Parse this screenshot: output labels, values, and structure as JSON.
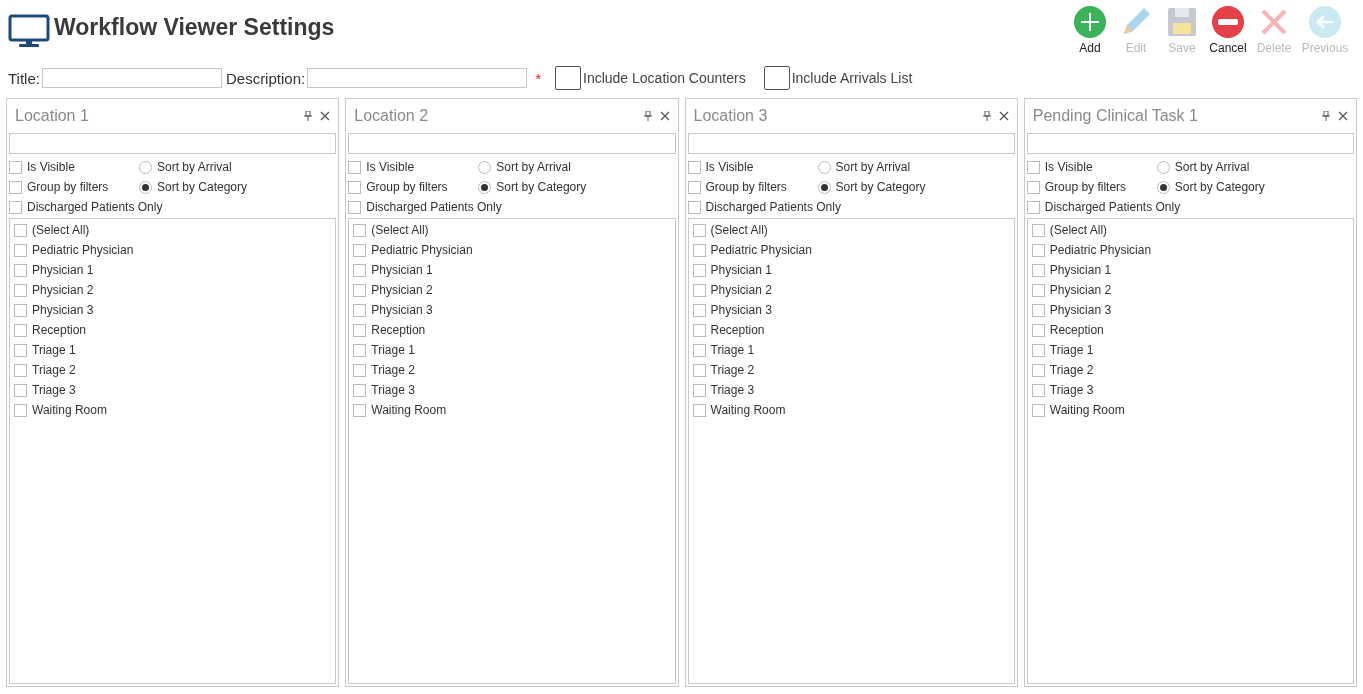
{
  "header": {
    "title": "Workflow Viewer Settings"
  },
  "toolbar": [
    {
      "label": "Add",
      "kind": "add",
      "disabled": false
    },
    {
      "label": "Edit",
      "kind": "edit",
      "disabled": true
    },
    {
      "label": "Save",
      "kind": "save",
      "disabled": true
    },
    {
      "label": "Cancel",
      "kind": "cancel",
      "disabled": false
    },
    {
      "label": "Delete",
      "kind": "delete",
      "disabled": true
    },
    {
      "label": "Previous",
      "kind": "previous",
      "disabled": true
    }
  ],
  "form": {
    "title_label": "Title:",
    "description_label": "Description:",
    "required_mark": "*",
    "options": [
      {
        "label": "Include Location Counters",
        "checked": false
      },
      {
        "label": "Include Arrivals List",
        "checked": false
      }
    ]
  },
  "panels": [
    {
      "title": "Location 1",
      "options": [
        {
          "kind": "checkbox",
          "label": "Is Visible",
          "checked": false
        },
        {
          "kind": "radio",
          "label": "Sort by Arrival",
          "selected": false
        },
        {
          "kind": "checkbox",
          "label": "Group by filters",
          "checked": false
        },
        {
          "kind": "radio",
          "label": "Sort by Category",
          "selected": true
        },
        {
          "kind": "checkbox",
          "label": "Discharged Patients Only",
          "checked": false
        }
      ],
      "items": [
        {
          "label": "(Select All)",
          "checked": false
        },
        {
          "label": "Pediatric Physician",
          "checked": false
        },
        {
          "label": "Physician 1",
          "checked": false
        },
        {
          "label": "Physician 2",
          "checked": false
        },
        {
          "label": "Physician 3",
          "checked": false
        },
        {
          "label": "Reception",
          "checked": false
        },
        {
          "label": "Triage 1",
          "checked": false
        },
        {
          "label": "Triage 2",
          "checked": false
        },
        {
          "label": "Triage 3",
          "checked": false
        },
        {
          "label": "Waiting Room",
          "checked": false
        }
      ]
    },
    {
      "title": "Location 2",
      "options": [
        {
          "kind": "checkbox",
          "label": "Is Visible",
          "checked": false
        },
        {
          "kind": "radio",
          "label": "Sort by Arrival",
          "selected": false
        },
        {
          "kind": "checkbox",
          "label": "Group by filters",
          "checked": false
        },
        {
          "kind": "radio",
          "label": "Sort by Category",
          "selected": true
        },
        {
          "kind": "checkbox",
          "label": "Discharged Patients Only",
          "checked": false
        }
      ],
      "items": [
        {
          "label": "(Select All)",
          "checked": false
        },
        {
          "label": "Pediatric Physician",
          "checked": false
        },
        {
          "label": "Physician 1",
          "checked": false
        },
        {
          "label": "Physician 2",
          "checked": false
        },
        {
          "label": "Physician 3",
          "checked": false
        },
        {
          "label": "Reception",
          "checked": false
        },
        {
          "label": "Triage 1",
          "checked": false
        },
        {
          "label": "Triage 2",
          "checked": false
        },
        {
          "label": "Triage 3",
          "checked": false
        },
        {
          "label": "Waiting Room",
          "checked": false
        }
      ]
    },
    {
      "title": "Location 3",
      "options": [
        {
          "kind": "checkbox",
          "label": "Is Visible",
          "checked": false
        },
        {
          "kind": "radio",
          "label": "Sort by Arrival",
          "selected": false
        },
        {
          "kind": "checkbox",
          "label": "Group by filters",
          "checked": false
        },
        {
          "kind": "radio",
          "label": "Sort by Category",
          "selected": true
        },
        {
          "kind": "checkbox",
          "label": "Discharged Patients Only",
          "checked": false
        }
      ],
      "items": [
        {
          "label": "(Select All)",
          "checked": false
        },
        {
          "label": "Pediatric Physician",
          "checked": false
        },
        {
          "label": "Physician 1",
          "checked": false
        },
        {
          "label": "Physician 2",
          "checked": false
        },
        {
          "label": "Physician 3",
          "checked": false
        },
        {
          "label": "Reception",
          "checked": false
        },
        {
          "label": "Triage 1",
          "checked": false
        },
        {
          "label": "Triage 2",
          "checked": false
        },
        {
          "label": "Triage 3",
          "checked": false
        },
        {
          "label": "Waiting Room",
          "checked": false
        }
      ]
    },
    {
      "title": "Pending Clinical Task 1",
      "options": [
        {
          "kind": "checkbox",
          "label": "Is Visible",
          "checked": false
        },
        {
          "kind": "radio",
          "label": "Sort by Arrival",
          "selected": false
        },
        {
          "kind": "checkbox",
          "label": "Group by filters",
          "checked": false
        },
        {
          "kind": "radio",
          "label": "Sort by Category",
          "selected": true
        },
        {
          "kind": "checkbox",
          "label": "Discharged Patients Only",
          "checked": false
        }
      ],
      "items": [
        {
          "label": "(Select All)",
          "checked": false
        },
        {
          "label": "Pediatric Physician",
          "checked": false
        },
        {
          "label": "Physician 1",
          "checked": false
        },
        {
          "label": "Physician 2",
          "checked": false
        },
        {
          "label": "Physician 3",
          "checked": false
        },
        {
          "label": "Reception",
          "checked": false
        },
        {
          "label": "Triage 1",
          "checked": false
        },
        {
          "label": "Triage 2",
          "checked": false
        },
        {
          "label": "Triage 3",
          "checked": false
        },
        {
          "label": "Waiting Room",
          "checked": false
        }
      ]
    }
  ]
}
